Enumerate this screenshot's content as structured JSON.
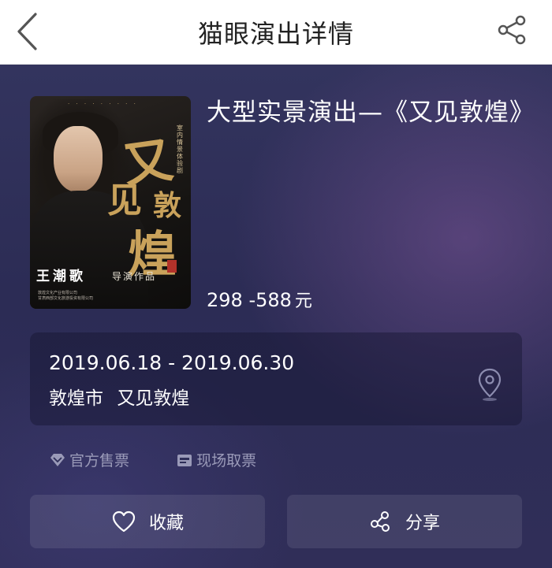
{
  "navbar": {
    "title": "猫眼演出详情",
    "back_icon": "chevron-left-icon",
    "share_icon": "share-icon"
  },
  "show": {
    "title": "大型实景演出—《又见敦煌》",
    "price_range": "298 -588",
    "price_unit": "元",
    "poster": {
      "top_text": "· · · · · · · · ·",
      "side_text": "室内情景体验剧",
      "calligraphy": [
        "又",
        "见",
        "敦",
        "煌"
      ],
      "director": "王潮歌",
      "credit": "导演作品",
      "company_lines": [
        "敦煌文化产业有限公司",
        "甘肃西部文化旅游投资有限公司"
      ]
    }
  },
  "info": {
    "dates": "2019.06.18 - 2019.06.30",
    "city": "敦煌市",
    "venue": "又见敦煌",
    "location_icon": "map-pin-icon"
  },
  "tags": [
    {
      "icon": "diamond-badge-icon",
      "label": "官方售票"
    },
    {
      "icon": "ticket-box-icon",
      "label": "现场取票"
    }
  ],
  "actions": {
    "favorite_label": "收藏",
    "share_label": "分享"
  },
  "colors": {
    "nav_bg": "#ffffff",
    "content_bg": "#2e2e58",
    "accent_gold": "#c9a25b",
    "tag_text": "#9a9ab8"
  }
}
